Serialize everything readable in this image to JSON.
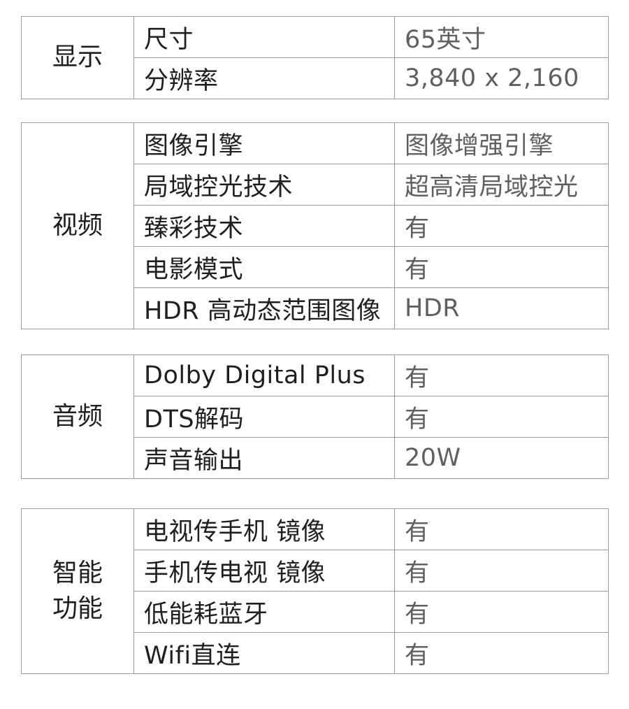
{
  "sections": [
    {
      "category": [
        "显示"
      ],
      "rows": [
        {
          "feature": "尺寸",
          "value": "65英寸"
        },
        {
          "feature": "分辨率",
          "value": "3,840 x 2,160"
        }
      ]
    },
    {
      "category": [
        "视频"
      ],
      "rows": [
        {
          "feature": "图像引擎",
          "value": "图像增强引擎"
        },
        {
          "feature": "局域控光技术",
          "value": "超高清局域控光"
        },
        {
          "feature": "臻彩技术",
          "value": "有"
        },
        {
          "feature": "电影模式",
          "value": "有"
        },
        {
          "feature": "HDR 高动态范围图像",
          "value": "HDR"
        }
      ]
    },
    {
      "category": [
        "音频"
      ],
      "rows": [
        {
          "feature": "Dolby Digital Plus",
          "value": "有"
        },
        {
          "feature": "DTS解码",
          "value": "有"
        },
        {
          "feature": "声音输出",
          "value": "20W"
        }
      ]
    },
    {
      "category": [
        "智能",
        "功能"
      ],
      "rows": [
        {
          "feature": "电视传手机 镜像",
          "value": "有"
        },
        {
          "feature": "手机传电视 镜像",
          "value": "有"
        },
        {
          "feature": "低能耗蓝牙",
          "value": "有"
        },
        {
          "feature": "Wifi直连",
          "value": "有"
        }
      ]
    }
  ]
}
